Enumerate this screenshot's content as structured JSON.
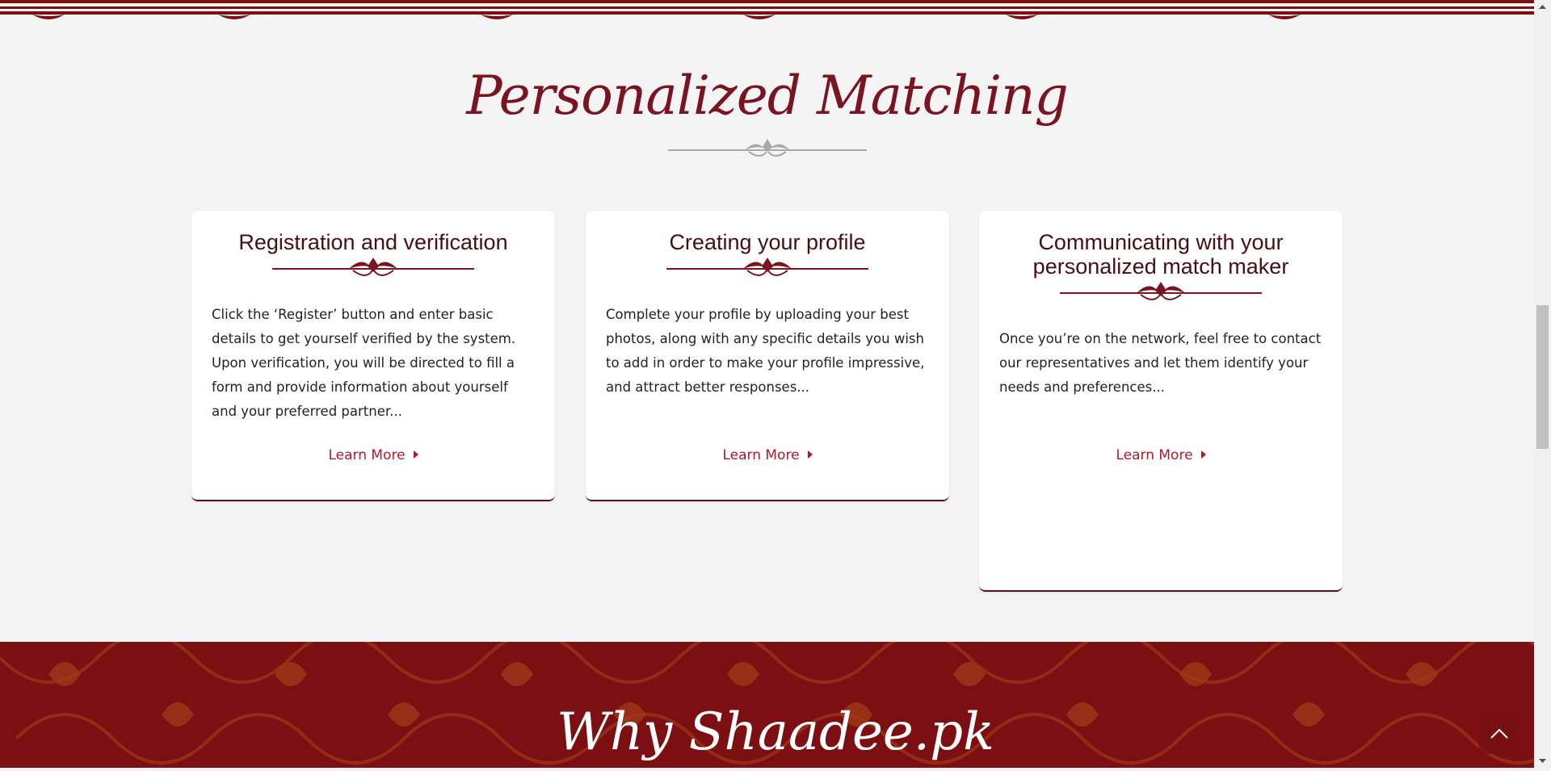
{
  "section": {
    "title": "Personalized Matching"
  },
  "cards": [
    {
      "title": "Registration and verification",
      "body": "Click the ‘Register’ button and enter basic details to get yourself verified by the system. Upon verification, you will be directed to fill a form and provide information about yourself and your preferred partner...",
      "link": "Learn More"
    },
    {
      "title": "Creating your profile",
      "body": "Complete your profile by uploading your best photos, along with any specific details you wish to add in order to make your profile impressive, and attract better responses...",
      "link": "Learn More"
    },
    {
      "title": "Communicating with your personalized match maker",
      "body": "Once you’re on the network, feel free to contact our representatives and let them identify your needs and preferences...",
      "link": "Learn More"
    }
  ],
  "why": {
    "title": "Why Shaadee.pk"
  },
  "colors": {
    "accent": "#b2182b",
    "maroon": "#7b0f12",
    "title": "#7a1420",
    "background": "#f4f4f4"
  },
  "icons": {
    "ornament": "floral-divider-icon",
    "to_top": "chevron-up-icon",
    "link_arrow": "caret-right-icon"
  }
}
